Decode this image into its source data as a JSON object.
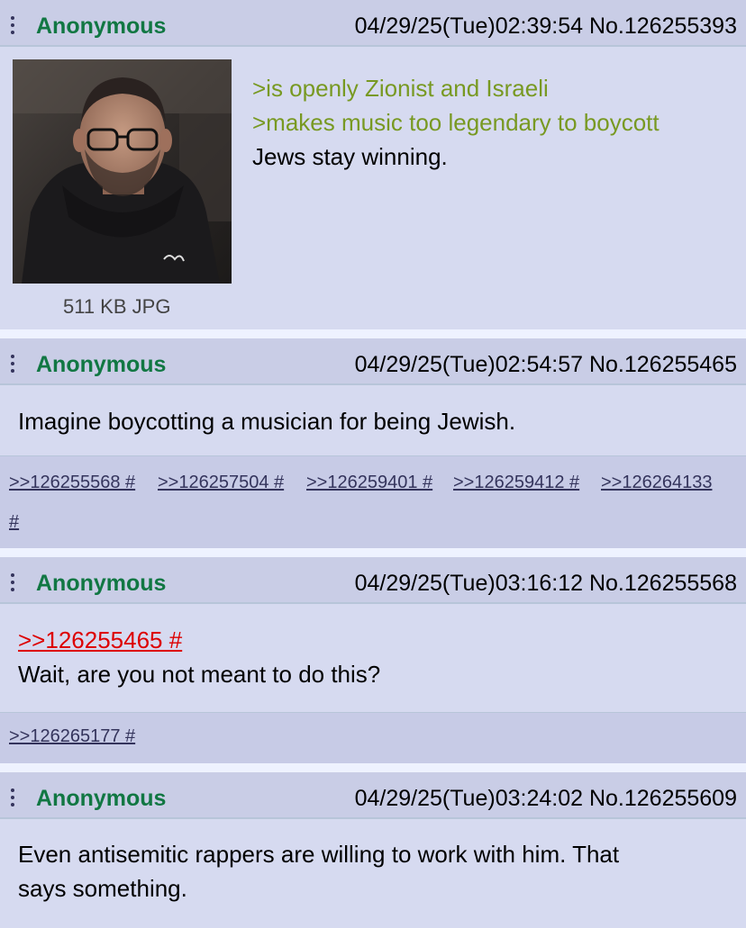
{
  "posts": [
    {
      "name": "Anonymous",
      "meta": "04/29/25(Tue)02:39:54 No.126255393",
      "image_alt": "photo of a man with glasses and a dark hoodie",
      "file_info": "511 KB JPG",
      "lines": [
        {
          "text": ">is openly Zionist and Israeli",
          "style": "greentext"
        },
        {
          "text": ">makes music too legendary to boycott",
          "style": "greentext"
        },
        {
          "text": "Jews stay winning.",
          "style": "normal"
        }
      ]
    },
    {
      "name": "Anonymous",
      "meta": "04/29/25(Tue)02:54:57 No.126255465",
      "text": "Imagine boycotting a musician for being Jewish.",
      "backlinks": [
        ">>126255568 #",
        ">>126257504 #",
        ">>126259401 #",
        ">>126259412 #",
        ">>126264133",
        "#"
      ]
    },
    {
      "name": "Anonymous",
      "meta": "04/29/25(Tue)03:16:12 No.126255568",
      "quote": ">>126255465 #",
      "text": "Wait, are you not meant to do this?",
      "backlinks": [
        ">>126265177 #"
      ]
    },
    {
      "name": "Anonymous",
      "meta": "04/29/25(Tue)03:24:02 No.126255609",
      "text_line1": "Even antisemitic rappers are willing to work with him. That",
      "text_line2": "says something."
    }
  ],
  "colors": {
    "post_bg": "#d6daf0",
    "header_bg": "#c9cde6",
    "name": "#117743",
    "greentext": "#789922",
    "quotelink": "#dd0000",
    "backlink": "#34345c"
  }
}
